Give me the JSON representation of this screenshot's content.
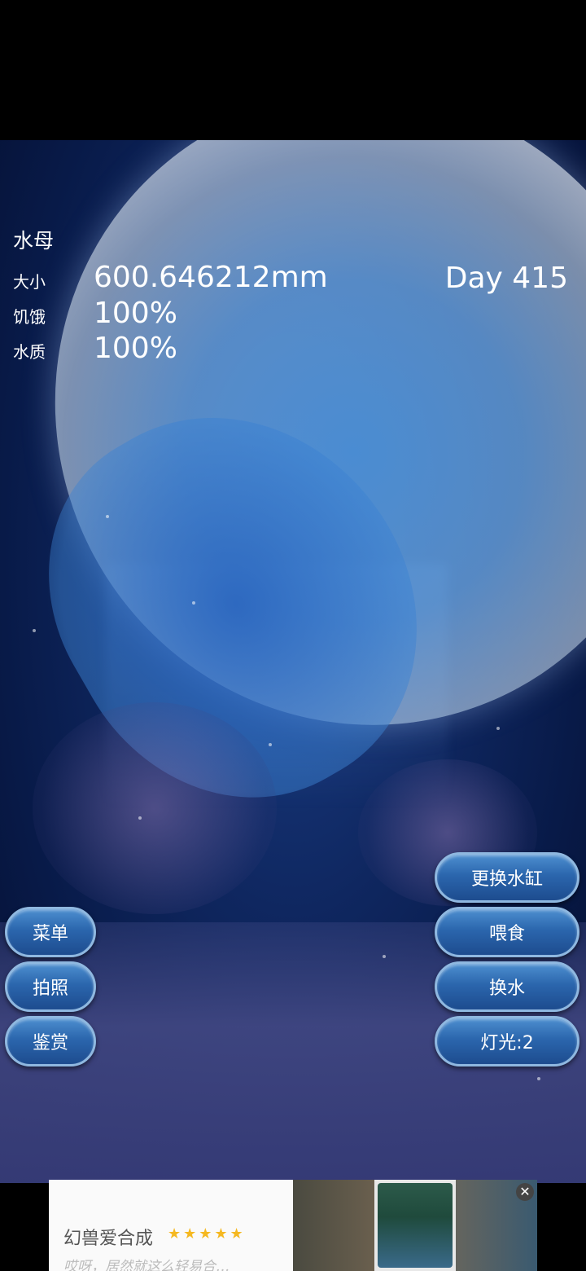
{
  "pet": {
    "title": "水母",
    "size_label": "大小",
    "size_value": "600.646212mm",
    "hunger_label": "饥饿",
    "hunger_value": "100%",
    "water_label": "水质",
    "water_value": "100%",
    "day": "Day 415"
  },
  "left_buttons": {
    "menu": "菜单",
    "photo": "拍照",
    "appreciate": "鉴赏"
  },
  "right_buttons": {
    "change_tank": "更换水缸",
    "feed": "喂食",
    "change_water": "换水",
    "light": "灯光:2"
  },
  "ad": {
    "title": "幻兽爱合成",
    "stars": "★★★★★",
    "subtitle": "哎呀，居然就这么轻易合…",
    "close": "✕"
  },
  "colors": {
    "button_top": "#4d8fd0",
    "button_bottom": "#1d4c8f",
    "button_border": "#8fb8e0",
    "water_deep": "#081a48"
  }
}
